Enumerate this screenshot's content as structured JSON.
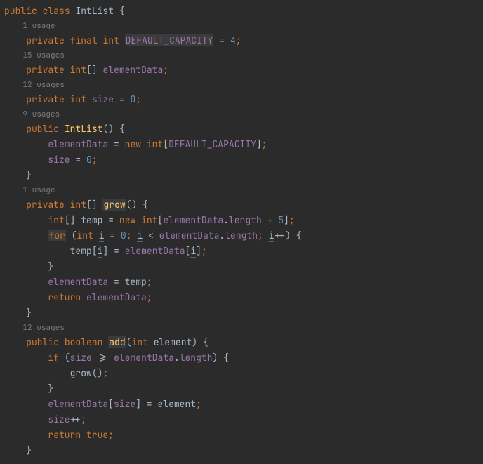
{
  "usages": {
    "u1": "1 usage",
    "u15": "15 usages",
    "u12": "12 usages",
    "u9": "9 usages",
    "u1b": "1 usage",
    "u12b": "12 usages"
  },
  "tokens": {
    "public": "public",
    "class": "class",
    "IntList": "IntList",
    "lbrace": "{",
    "rbrace": "}",
    "private": "private",
    "final": "final",
    "int": "int",
    "DEFAULT_CAPACITY": "DEFAULT_CAPACITY",
    "eq": "=",
    "four": "4",
    "semi": ";",
    "lbr": "[",
    "rbr": "]",
    "elementData": "elementData",
    "size": "size",
    "zero": "0",
    "lp": "(",
    "rp": ")",
    "new": "new",
    "grow": "grow",
    "temp": "temp",
    "dot": ".",
    "length": "length",
    "plus": "+",
    "five": "5",
    "for": "for",
    "i": "i",
    "lt": "<",
    "pp": "++",
    "return": "return",
    "boolean": "boolean",
    "add": "add",
    "element": "element",
    "if": "if",
    "ge": ">=",
    "true": "true",
    "sp1": " ",
    "sp4": "    ",
    "sp8": "        ",
    "sp12": "            "
  }
}
